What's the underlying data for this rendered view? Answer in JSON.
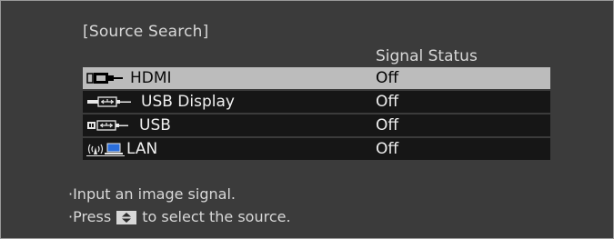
{
  "window": {
    "title": "[Source Search]",
    "column_header": "Signal Status"
  },
  "sources": [
    {
      "name": "HDMI",
      "status": "Off",
      "icon": "hdmi-connector-icon",
      "selected": true
    },
    {
      "name": "USB Display",
      "status": "Off",
      "icon": "usb-display-icon",
      "selected": false
    },
    {
      "name": "USB",
      "status": "Off",
      "icon": "usb-icon",
      "selected": false
    },
    {
      "name": "LAN",
      "status": "Off",
      "icon": "lan-wireless-icon",
      "selected": false
    }
  ],
  "help": {
    "line1": "·Input an image signal.",
    "line2_prefix": "·Press",
    "line2_key_icon": "up-down-arrow-key-icon",
    "line2_suffix": "to select the source."
  },
  "colors": {
    "background": "#3b3b3b",
    "row": "#161616",
    "row_selected": "#bcbcbc",
    "text": "#d8d8d8"
  }
}
